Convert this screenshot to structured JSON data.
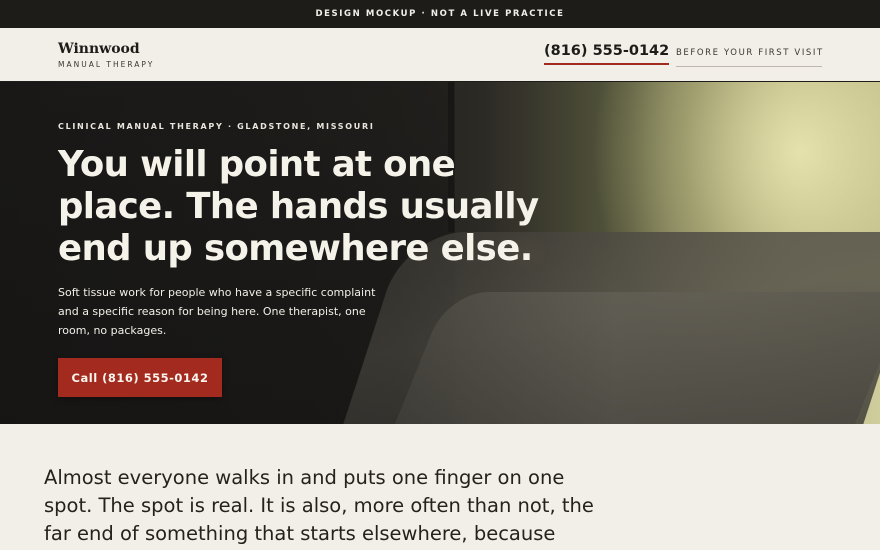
{
  "banner": {
    "text": "DESIGN MOCKUP · NOT A LIVE PRACTICE"
  },
  "header": {
    "brand_name": "Winnwood",
    "brand_tagline": "MANUAL THERAPY",
    "phone": "(816) 555-0142",
    "nav_link": "BEFORE YOUR FIRST VISIT"
  },
  "hero": {
    "eyebrow": "CLINICAL MANUAL THERAPY · GLADSTONE, MISSOURI",
    "headline": "You will point at one place. The hands usually end up somewhere else.",
    "subcopy": "Soft tissue work for people who have a specific complaint and a specific reason for being here. One therapist, one room, no packages.",
    "cta_label": "Call (816) 555-0142"
  },
  "intro": {
    "text": "Almost everyone walks in and puts one finger on one spot. The spot is real. It is also, more often than not, the far end of something that starts elsewhere, because muscle runs in"
  },
  "colors": {
    "accent": "#a32a1e",
    "dark": "#1e1c19",
    "background": "#f2efe8"
  }
}
